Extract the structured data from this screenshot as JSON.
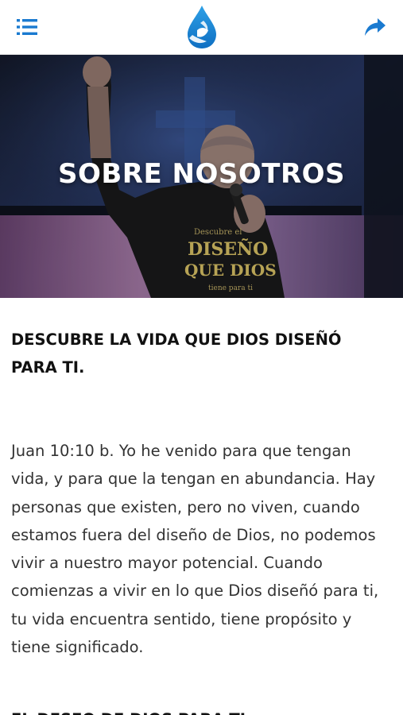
{
  "header": {
    "menu_icon": "menu-list-icon",
    "logo_icon": "water-drop-logo-icon",
    "share_icon": "share-arrow-icon",
    "accent_color": "#1a7ad0"
  },
  "hero": {
    "title": "SOBRE NOSOTROS",
    "image_subject": "preacher-with-microphone-photo",
    "shirt_text_line1": "Descubre el",
    "shirt_text_line2": "DISEÑO",
    "shirt_text_line3": "QUE DIOS",
    "shirt_text_line4": "tiene para ti"
  },
  "content": {
    "heading": "DESCUBRE LA VIDA QUE DIOS DISEÑÓ PARA TI.",
    "paragraph": "Juan 10:10 b. Yo he venido para que tengan vida, y para que la tengan en abundancia. Hay personas que existen, pero no viven, cuando estamos fuera del diseño de Dios, no podemos vivir a nuestro mayor potencial. Cuando comienzas a vivir en lo que Dios diseñó para ti, tu vida encuentra sentido, tiene propósito y tiene significado.",
    "heading_2": "EL DESEO DE DIOS PARA TI"
  }
}
